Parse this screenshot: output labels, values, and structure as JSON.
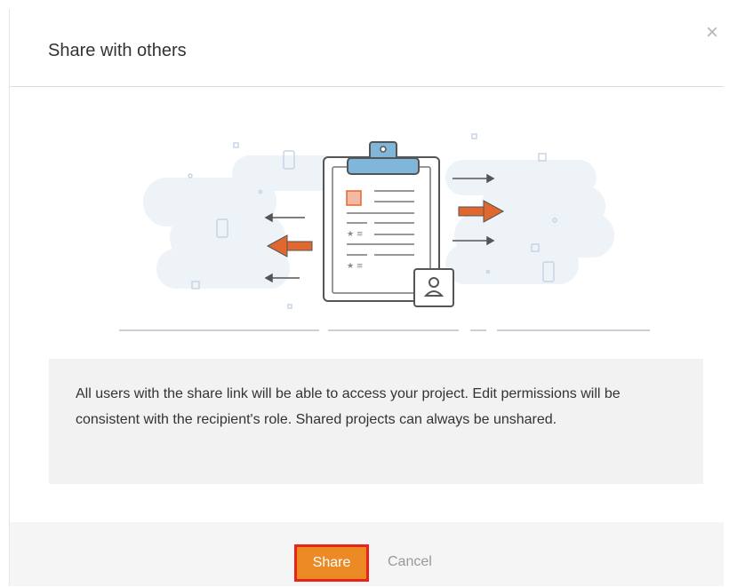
{
  "dialog": {
    "title": "Share with others",
    "close_glyph": "×",
    "message": "All users with the share link will be able to access your project. Edit permissions will be consistent with the recipient's role. Shared projects can always be unshared.",
    "share_label": "Share",
    "cancel_label": "Cancel"
  },
  "illustration": {
    "icon": "clipboard-share-illustration",
    "colors": {
      "clipboard_clip": "#7fb6d9",
      "arrow_accent": "#e0682f",
      "background_blob": "#eef3f8",
      "outline": "#555555"
    }
  },
  "colors": {
    "share_button": "#ec8a25",
    "share_button_highlight_border": "#e8231c",
    "info_box_background": "#f2f2f2",
    "footer_background": "#f5f5f5"
  }
}
